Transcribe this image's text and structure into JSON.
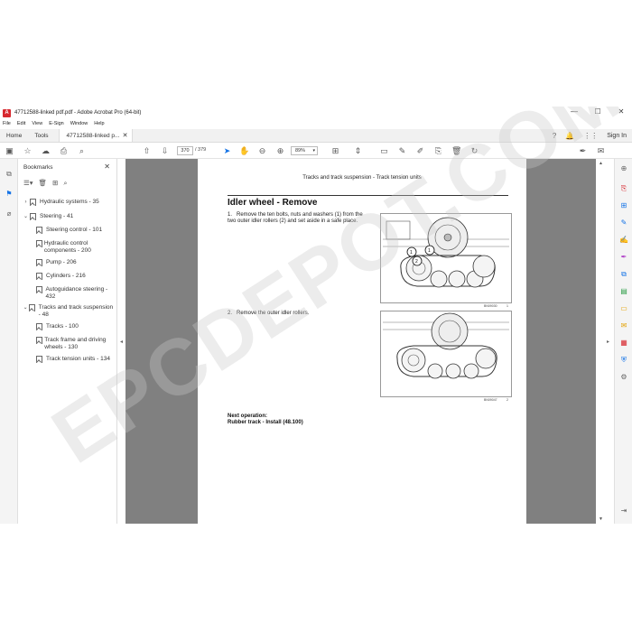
{
  "window": {
    "title": "47712588-linked pdf.pdf - Adobe Acrobat Pro (64-bit)",
    "minimize": "—",
    "maximize": "☐",
    "close": "✕"
  },
  "menu": [
    "File",
    "Edit",
    "View",
    "E-Sign",
    "Window",
    "Help"
  ],
  "tabs": {
    "home": "Home",
    "tools": "Tools",
    "document": "47712588-linked p...",
    "close": "✕",
    "sign_in": "Sign In"
  },
  "toolbar": {
    "current_page": "370",
    "page_total": "/  379",
    "zoom": "89%"
  },
  "bookmarks": {
    "title": "Bookmarks",
    "close": "✕",
    "items": [
      {
        "label": "Hydraulic systems - 35",
        "level": 0,
        "chevron": "›"
      },
      {
        "label": "Steering - 41",
        "level": 0,
        "chevron": "⌄"
      },
      {
        "label": "Steering control - 101",
        "level": 1
      },
      {
        "label": "Hydraulic control components - 200",
        "level": 1
      },
      {
        "label": "Pump - 206",
        "level": 1
      },
      {
        "label": "Cylinders - 216",
        "level": 1
      },
      {
        "label": "Autoguidance steering - 432",
        "level": 1
      },
      {
        "label": "Tracks and track suspension - 48",
        "level": 0,
        "chevron": "⌄"
      },
      {
        "label": "Tracks - 100",
        "level": 1
      },
      {
        "label": "Track frame and driving wheels - 130",
        "level": 1
      },
      {
        "label": "Track tension units - 134",
        "level": 1
      }
    ]
  },
  "document": {
    "running_head": "Tracks and track suspension - Track tension units",
    "title": "Idler wheel - Remove",
    "steps": [
      {
        "num": "1.",
        "text": "Remove the ten bolts, nuts and washers (1) from the two outer idler rollers (2) and set aside in a safe place."
      },
      {
        "num": "2.",
        "text": "Remove the outer idler rollers."
      }
    ],
    "figures": [
      {
        "code": "BN09030",
        "index": "1"
      },
      {
        "code": "BN09047",
        "index": "2"
      }
    ],
    "callouts": [
      "1",
      "2"
    ],
    "next_operation_label": "Next operation:",
    "next_operation": "Rubber track - Install (48.100)"
  },
  "watermark": "EPCDEPOT.COM",
  "colors": {
    "accent": "#1473e6",
    "acrobat_red": "#d7282f",
    "viewport_bg": "#808080"
  }
}
